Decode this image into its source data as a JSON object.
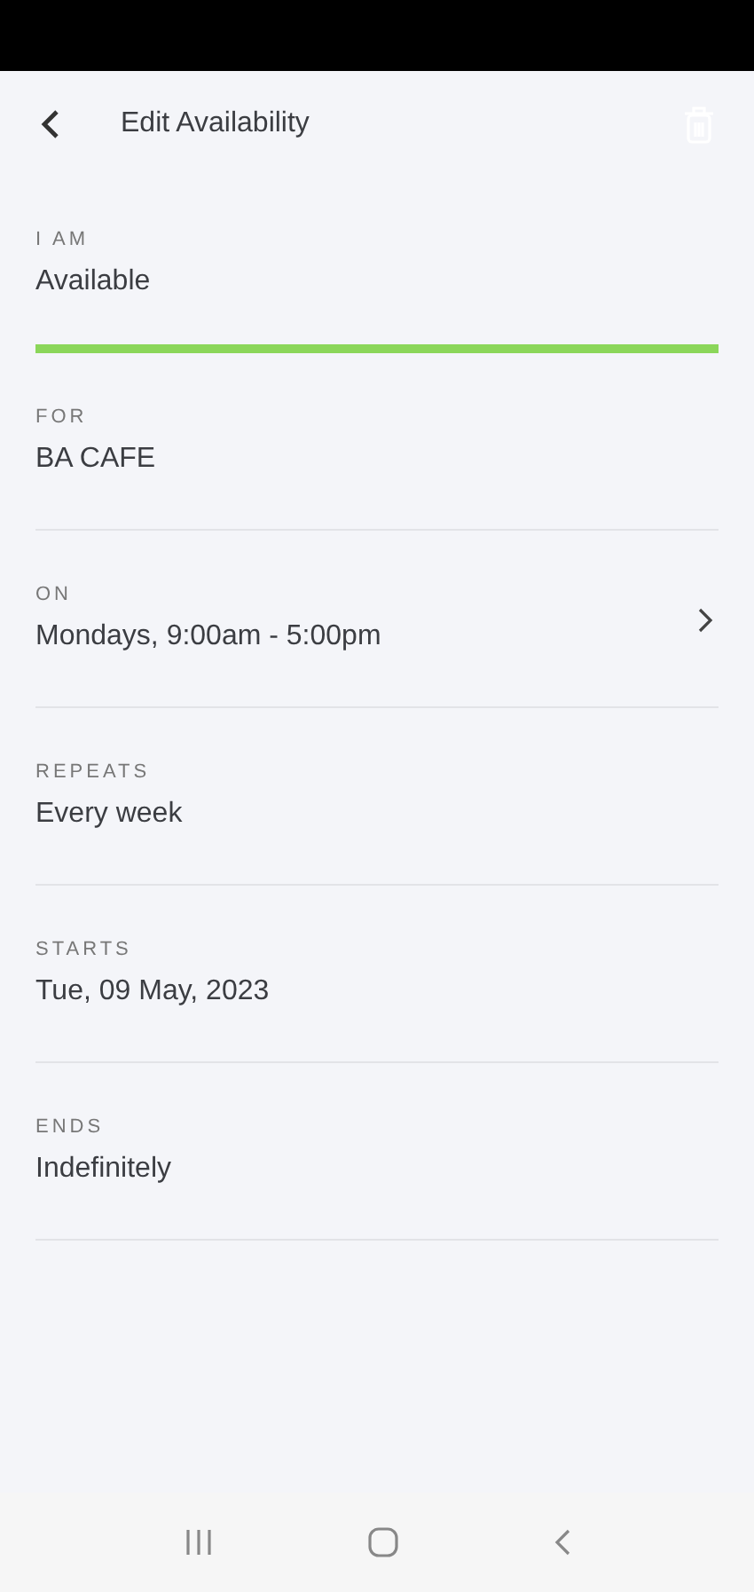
{
  "header": {
    "title": "Edit Availability"
  },
  "fields": [
    {
      "label": "I AM",
      "value": "Available",
      "kind": "plain",
      "selected": true
    },
    {
      "label": "FOR",
      "value": "BA CAFE",
      "kind": "plain",
      "selected": false
    },
    {
      "label": "ON",
      "value": "Mondays, 9:00am - 5:00pm",
      "kind": "link",
      "selected": false
    },
    {
      "label": "REPEATS",
      "value": "Every week",
      "kind": "plain",
      "selected": false
    },
    {
      "label": "STARTS",
      "value": "Tue, 09 May, 2023",
      "kind": "plain",
      "selected": false
    },
    {
      "label": "ENDS",
      "value": "Indefinitely",
      "kind": "plain",
      "selected": false
    }
  ]
}
